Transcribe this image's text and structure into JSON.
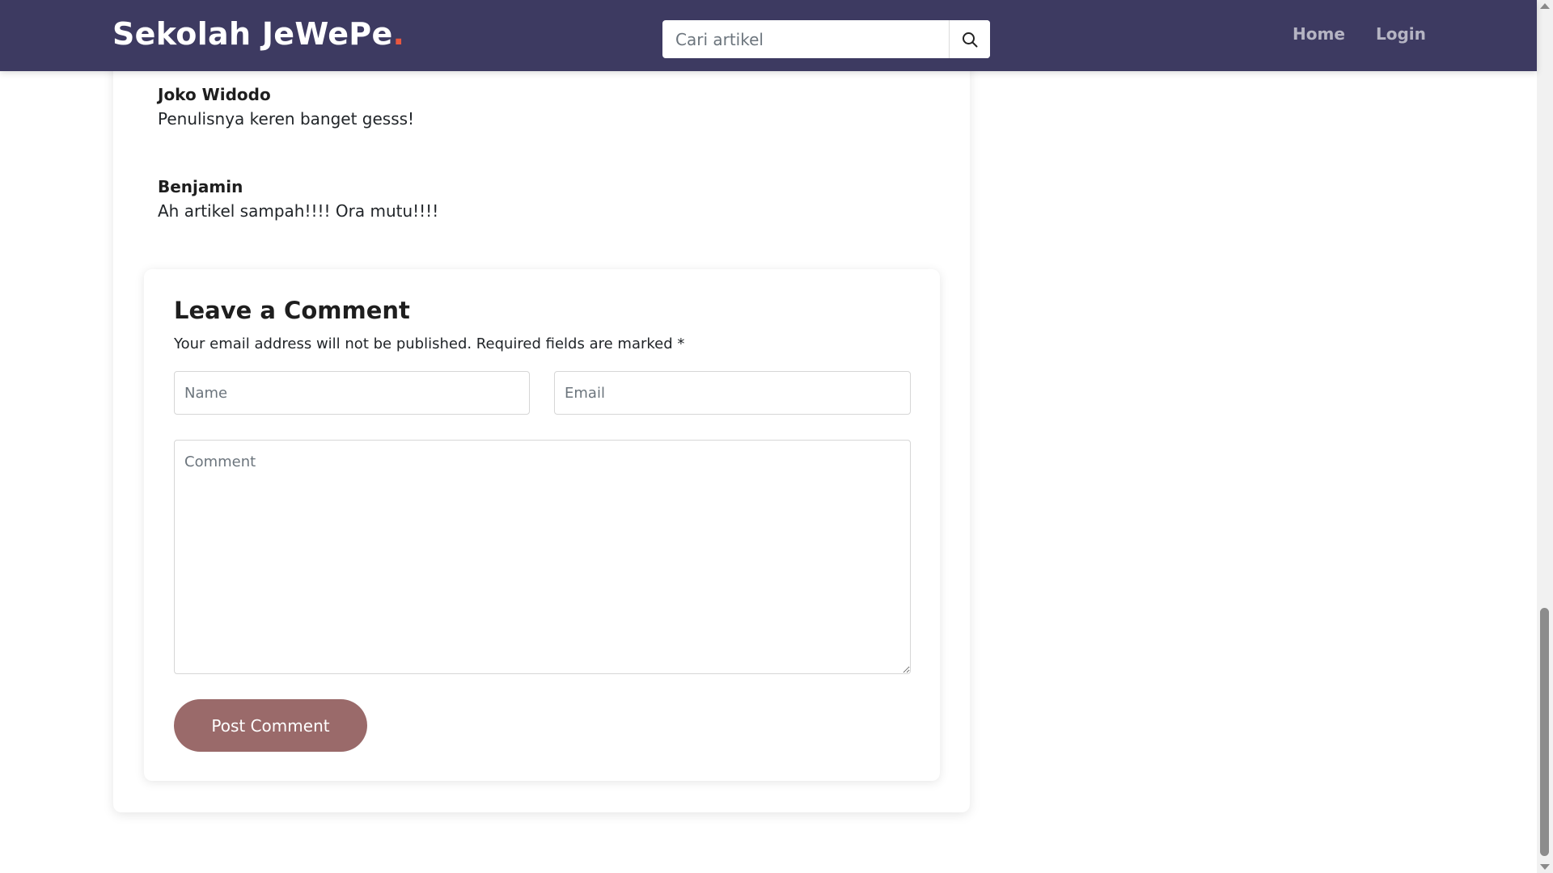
{
  "navbar": {
    "brand": "Sekolah JeWePe",
    "brand_dot": ".",
    "search_placeholder": "Cari artikel",
    "links": [
      {
        "label": "Home"
      },
      {
        "label": "Login"
      }
    ]
  },
  "comments": [
    {
      "author": "Joko Widodo",
      "text": "Penulisnya keren banget gesss!"
    },
    {
      "author": "Benjamin",
      "text": "Ah artikel sampah!!!! Ora mutu!!!!"
    }
  ],
  "comment_form": {
    "title": "Leave a Comment",
    "note": "Your email address will not be published. Required fields are marked *",
    "name_placeholder": "Name",
    "email_placeholder": "Email",
    "comment_placeholder": "Comment",
    "submit_label": "Post Comment"
  },
  "icons": {
    "search": "search-icon"
  },
  "colors": {
    "navbar_bg": "#3d3a61",
    "brand_accent": "#e9573f",
    "button_bg": "#9a6a6a"
  }
}
